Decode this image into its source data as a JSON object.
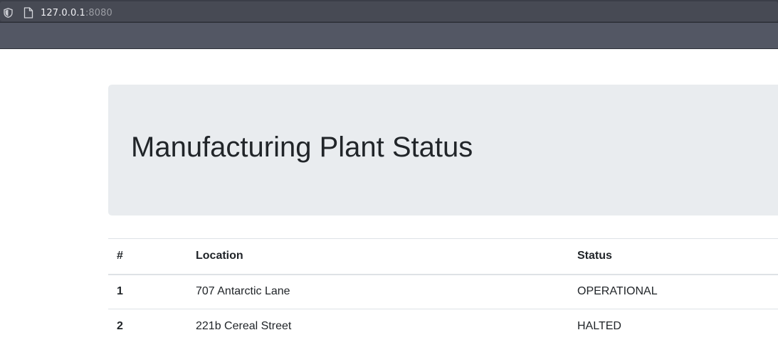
{
  "browser": {
    "url_host": "127.0.0.1",
    "url_port": ":8080",
    "icons": [
      "shield-icon",
      "page-icon"
    ]
  },
  "jumbotron": {
    "title": "Manufacturing Plant Status"
  },
  "table": {
    "headers": [
      "#",
      "Location",
      "Status"
    ],
    "rows": [
      {
        "num": "1",
        "location": "707 Antarctic Lane",
        "status": "OPERATIONAL"
      },
      {
        "num": "2",
        "location": "221b Cereal Street",
        "status": "HALTED"
      }
    ]
  }
}
